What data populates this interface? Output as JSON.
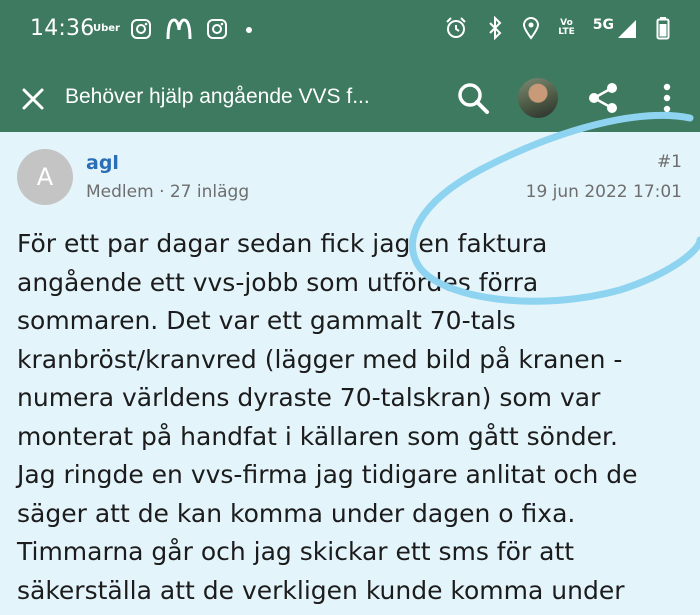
{
  "status": {
    "time": "14:36",
    "uber_label": "Uber",
    "network": "5G",
    "volte_top": "Vo",
    "volte_bottom": "LTE",
    "left_icons": [
      "instagram-icon",
      "mcdonalds-icon",
      "instagram-icon",
      "dot-icon"
    ],
    "right_icons": [
      "alarm-icon",
      "bluetooth-icon",
      "location-icon",
      "volte-icon",
      "signal-icon",
      "battery-icon"
    ]
  },
  "appbar": {
    "title": "Behöver hjälp angående VVS f...",
    "icons": [
      "close-icon",
      "search-icon",
      "avatar",
      "share-icon",
      "more-vert-icon"
    ]
  },
  "post": {
    "avatar_letter": "A",
    "username": "agl",
    "meta": "Medlem · 27 inlägg",
    "number": "#1",
    "date": "19 jun 2022 17:01",
    "body_lines": [
      "För ett par dagar sedan fick jag en faktura",
      "angående ett vvs-jobb som utfördes förra",
      "sommaren. Det var ett gammalt 70-tals",
      "kranbröst/kranvred (lägger med bild på kranen -",
      "numera världens dyraste 70-talskran) som var",
      "monterat på handfat i källaren som gått sönder.",
      "Jag ringde en vvs-firma jag tidigare anlitat och de",
      "säger att de kan komma under dagen o fixa.",
      "Timmarna går och jag skickar ett sms för att",
      "säkerställa att de verkligen kunde komma under"
    ]
  },
  "colors": {
    "header": "#3d7a60",
    "background": "#e3f4fb",
    "username": "#2a6fb5",
    "annotation": "#8ed4f0"
  }
}
